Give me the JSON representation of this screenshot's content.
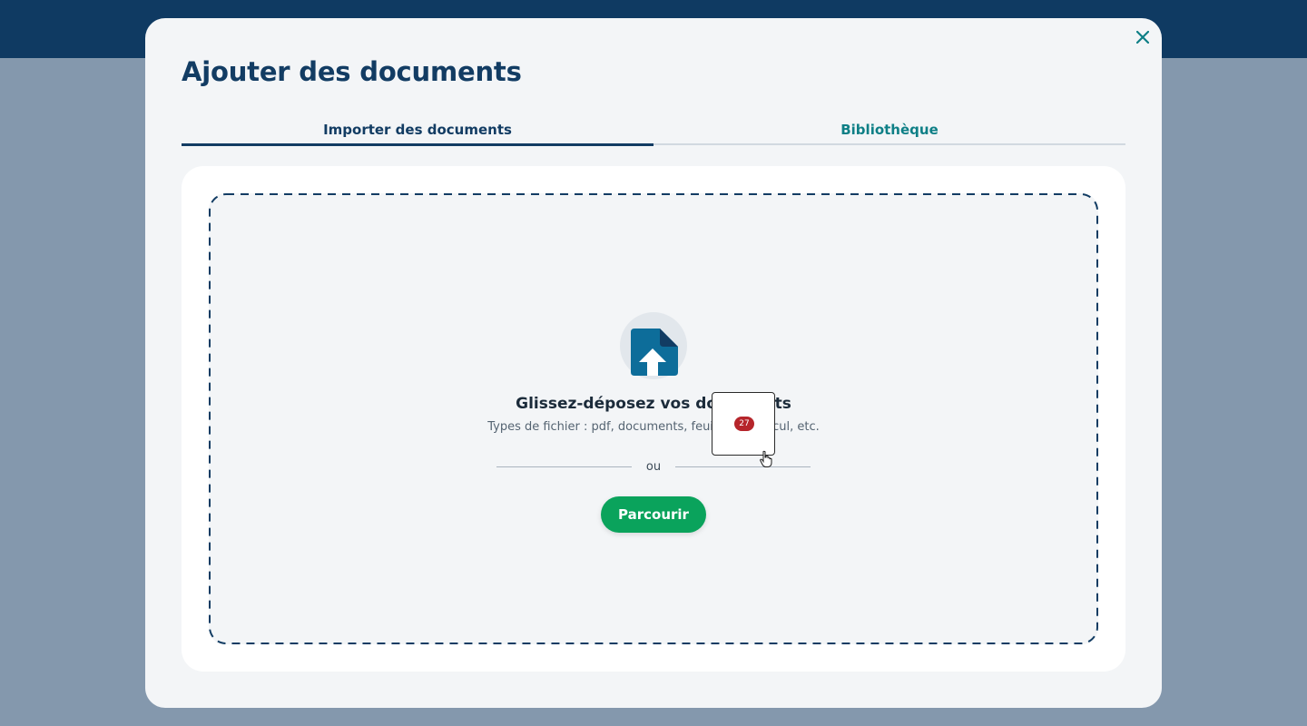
{
  "modal": {
    "title": "Ajouter des documents",
    "close_icon": "close-icon"
  },
  "tabs": [
    {
      "label": "Importer des documents",
      "active": true
    },
    {
      "label": "Bibliothèque",
      "active": false
    }
  ],
  "dropzone": {
    "icon": "file-upload-icon",
    "title": "Glissez-déposez vos documents",
    "subtitle": "Types de fichier : pdf, documents, feuilles de calcul, etc.",
    "separator": "ou",
    "browse_label": "Parcourir"
  },
  "drag_ghost": {
    "count": "27"
  },
  "colors": {
    "primary": "#123c63",
    "accent": "#0e7f86",
    "button": "#0aa35c",
    "badge": "#b6252b"
  }
}
